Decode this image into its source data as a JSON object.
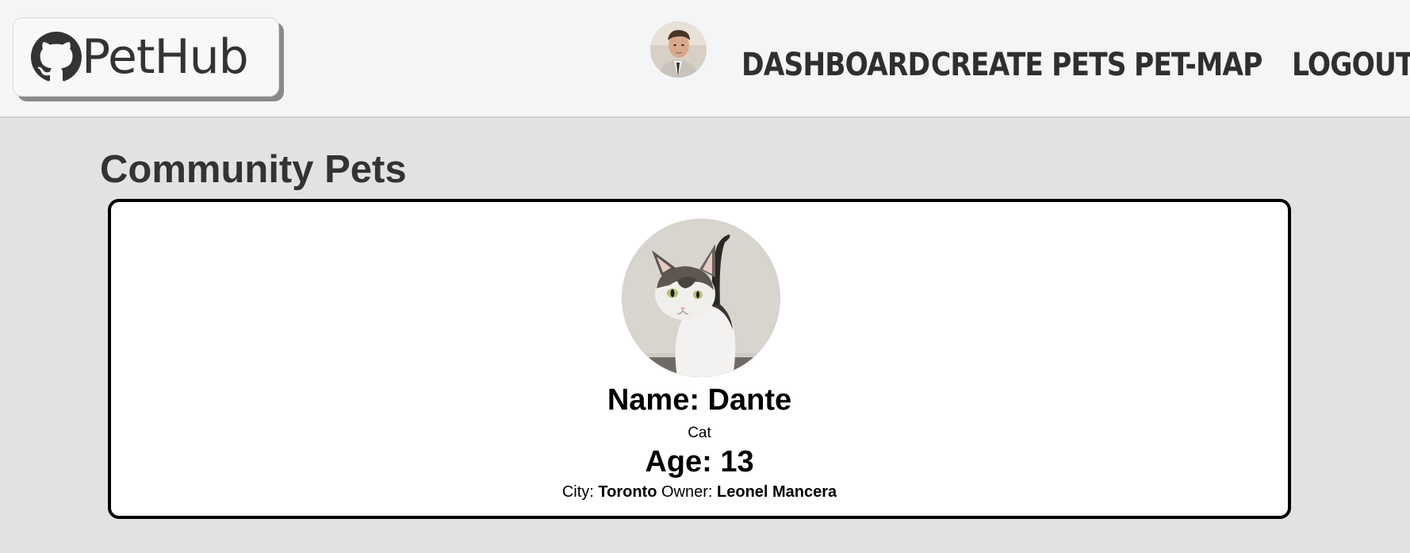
{
  "app": {
    "logo_text": "PetHub"
  },
  "nav": {
    "links": [
      {
        "label": "DASHBOARD"
      },
      {
        "label": "CREATE PETS"
      },
      {
        "label": "PET-MAP"
      },
      {
        "label": "LOGOUT"
      }
    ]
  },
  "page": {
    "title": "Community Pets"
  },
  "pets": [
    {
      "name_label": "Name: Dante",
      "species": "Cat",
      "age_label": "Age: 13",
      "city_label": "City:",
      "city": "Toronto",
      "owner_label": "Owner:",
      "owner": "Leonel Mancera"
    }
  ],
  "colors": {
    "header_bg": "#f3f5f6",
    "page_bg": "#e2e2e2",
    "card_border": "#000000",
    "text": "#333333"
  }
}
